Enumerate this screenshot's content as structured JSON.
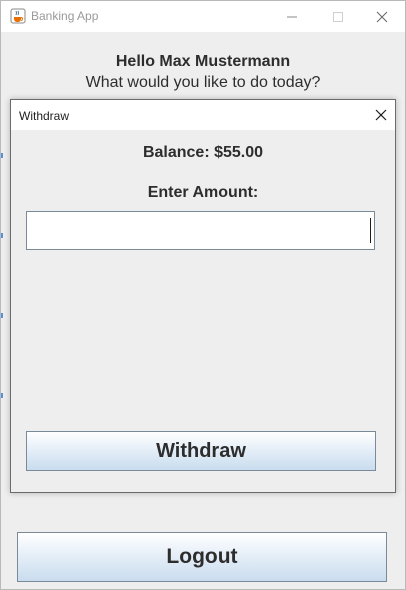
{
  "window": {
    "title": "Banking App",
    "icon": "java-cup-icon"
  },
  "main": {
    "greeting": "Hello Max Mustermann",
    "subgreeting": "What would you like to do today?",
    "logout_label": "Logout"
  },
  "dialog": {
    "title": "Withdraw",
    "balance_text": "Balance: $55.00",
    "amount_label": "Enter Amount:",
    "amount_value": "",
    "withdraw_label": "Withdraw"
  },
  "colors": {
    "button_gradient_top": "#ffffff",
    "button_gradient_bottom": "#c9dcee",
    "background": "#eeeeee"
  }
}
